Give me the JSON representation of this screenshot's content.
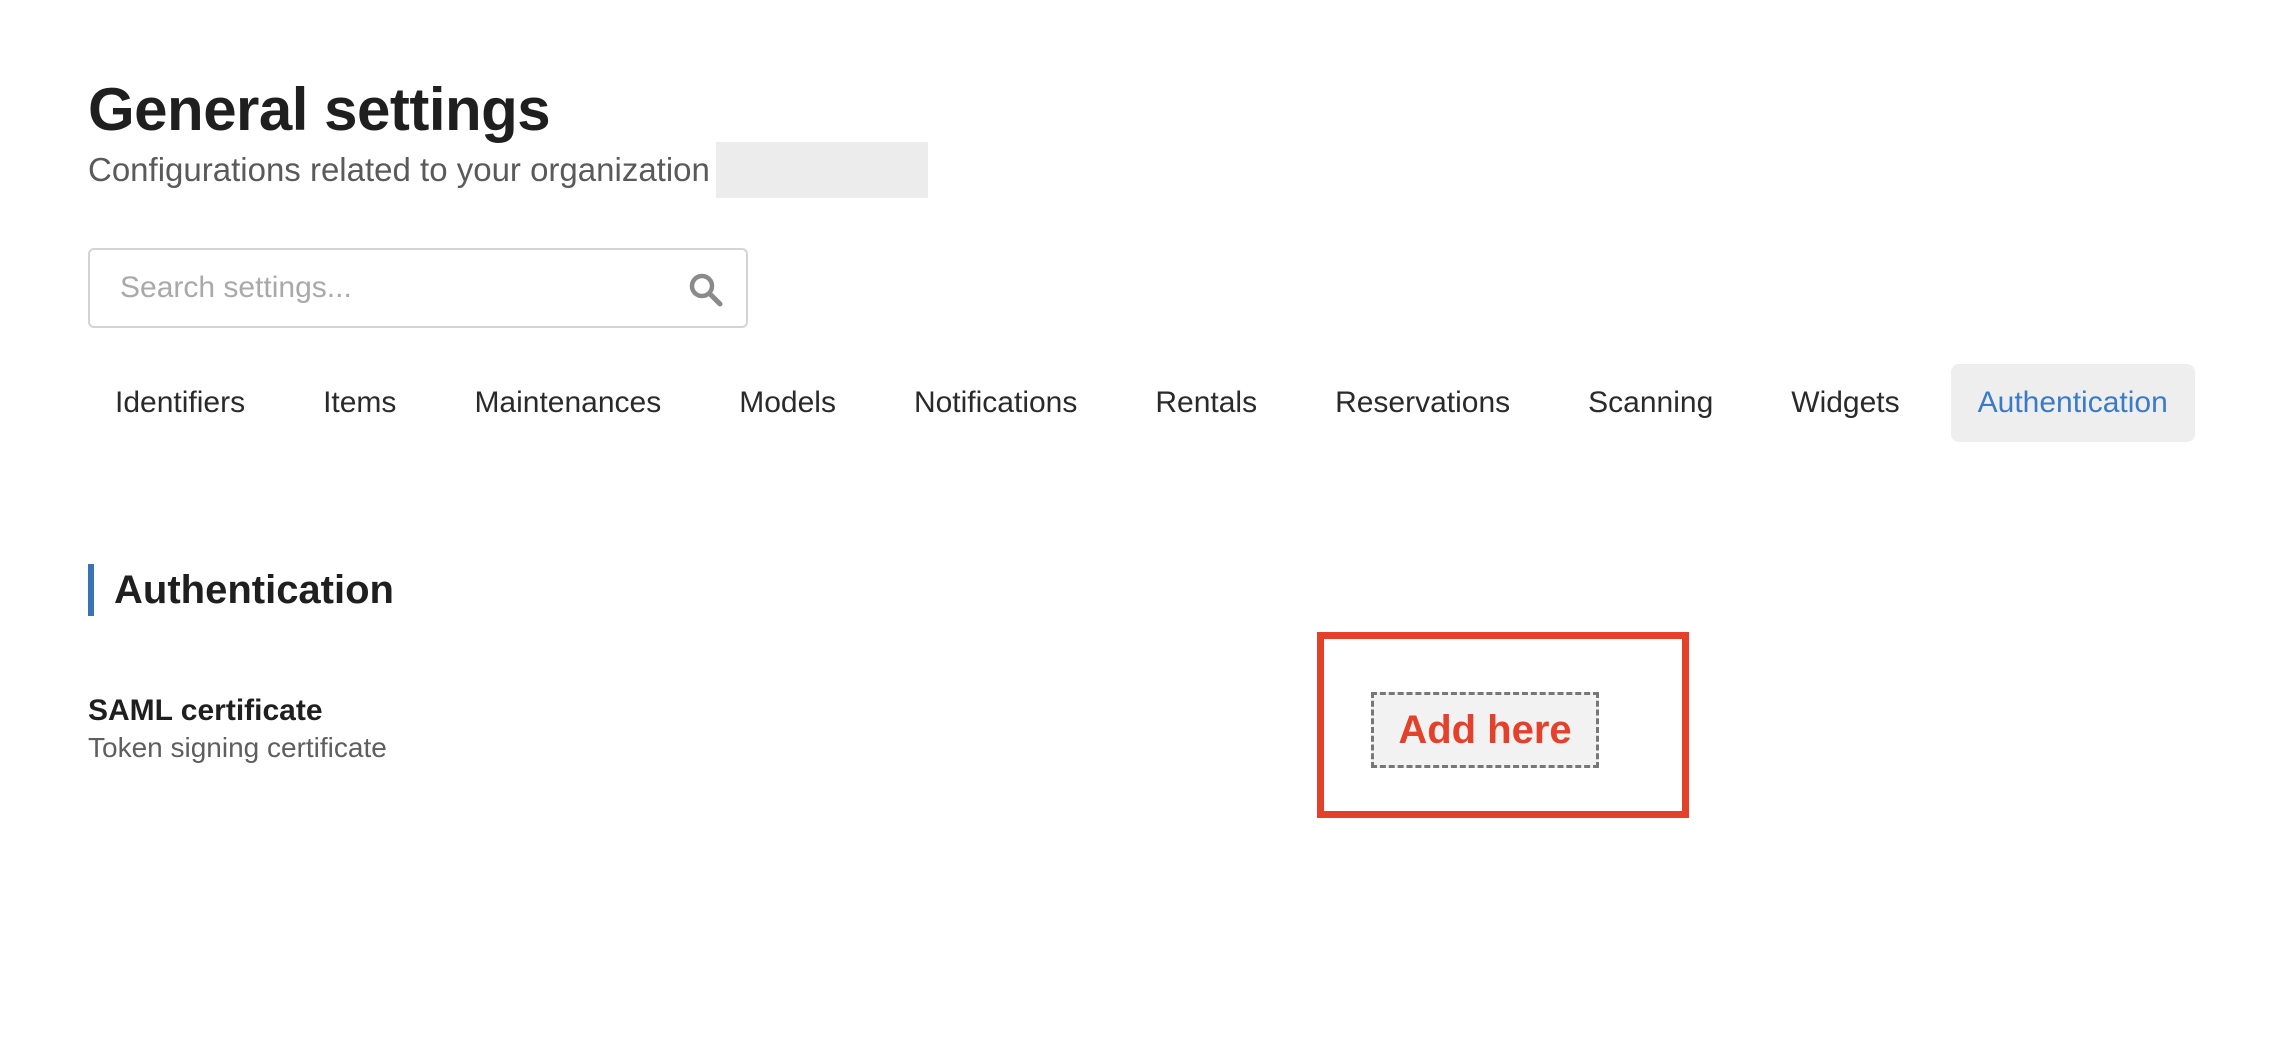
{
  "header": {
    "title": "General settings",
    "subtitle": "Configurations related to your organization"
  },
  "search": {
    "placeholder": "Search settings...",
    "value": "",
    "icon": "search-icon"
  },
  "tabs": [
    {
      "label": "Identifiers",
      "active": false
    },
    {
      "label": "Items",
      "active": false
    },
    {
      "label": "Maintenances",
      "active": false
    },
    {
      "label": "Models",
      "active": false
    },
    {
      "label": "Notifications",
      "active": false
    },
    {
      "label": "Rentals",
      "active": false
    },
    {
      "label": "Reservations",
      "active": false
    },
    {
      "label": "Scanning",
      "active": false
    },
    {
      "label": "Widgets",
      "active": false
    },
    {
      "label": "Authentication",
      "active": true
    }
  ],
  "section": {
    "title": "Authentication",
    "settings": [
      {
        "label": "SAML certificate",
        "description": "Token signing certificate",
        "action_label": "Add here"
      }
    ]
  },
  "colors": {
    "accent": "#3a7bc8",
    "section_bar": "#3a72b8",
    "highlight": "#e5402a",
    "active_tab_bg": "#eeeeee"
  }
}
